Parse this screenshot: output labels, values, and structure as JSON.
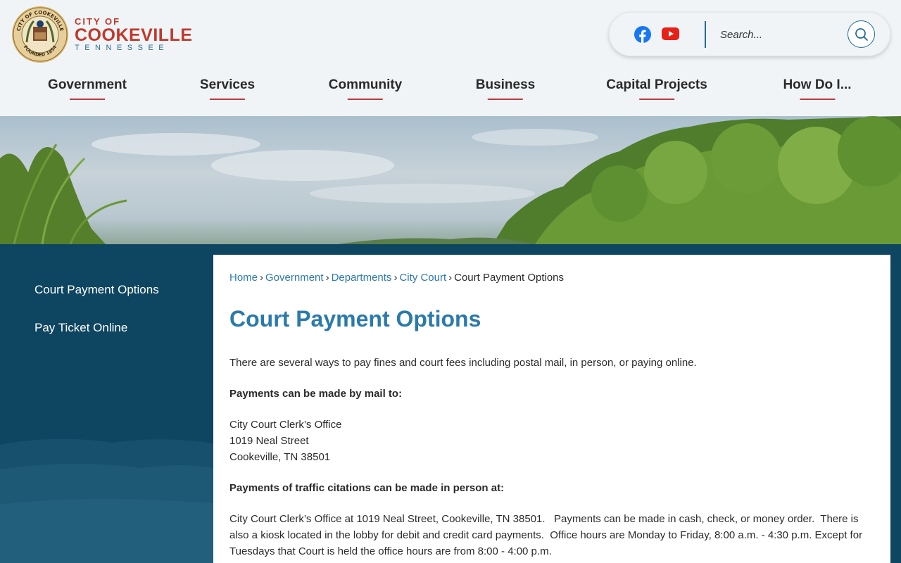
{
  "header": {
    "wordmark": {
      "city_of": "CITY OF",
      "name": "COOKEVILLE",
      "state": "TENNESSEE"
    },
    "seal": {
      "top_text": "CITY OF COOKEVILLE",
      "bottom_text": "FOUNDED 1854"
    },
    "search": {
      "placeholder": "Search..."
    }
  },
  "nav": [
    {
      "label": "Government"
    },
    {
      "label": "Services"
    },
    {
      "label": "Community"
    },
    {
      "label": "Business"
    },
    {
      "label": "Capital Projects"
    },
    {
      "label": "How Do I..."
    }
  ],
  "sidebar": {
    "items": [
      {
        "label": "Court Payment Options"
      },
      {
        "label": "Pay Ticket Online"
      }
    ]
  },
  "breadcrumb": {
    "items": [
      "Home",
      "Government",
      "Departments",
      "City Court"
    ],
    "current": "Court Payment Options"
  },
  "main": {
    "title": "Court Payment Options",
    "intro": "There are several ways to pay fines and court fees including postal mail, in person, or paying online.",
    "mail_heading": "Payments can be made by mail to:",
    "address": [
      "City Court Clerk’s Office",
      "1019 Neal Street",
      "Cookeville, TN 38501"
    ],
    "in_person_heading": "Payments of traffic citations can be made in person at:",
    "in_person_text": "City Court Clerk’s Office at 1019 Neal Street, Cookeville, TN 38501.   Payments can be made in cash, check, or money order.  There is also a kiosk located in the lobby for debit and credit card payments.  Office hours are Monday to Friday, 8:00 a.m. - 4:30 p.m. Except for Tuesdays that Court is held the office hours are from 8:00 - 4:00 p.m."
  },
  "colors": {
    "brand_red": "#c0392b",
    "link_blue": "#2b7aab",
    "sidebar_navy": "#0e4560",
    "nav_underline": "#b73a3f"
  }
}
